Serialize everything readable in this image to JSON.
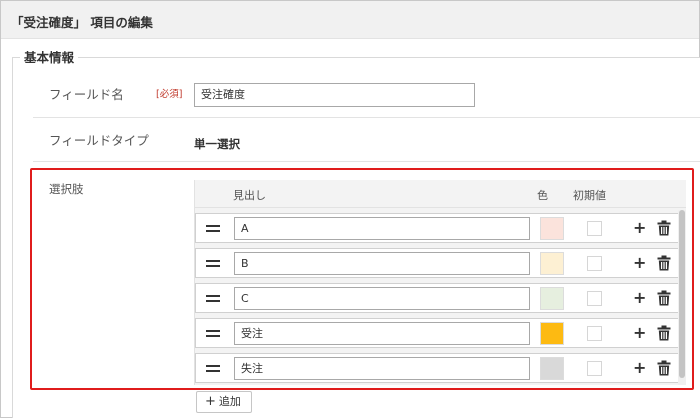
{
  "header": {
    "title": "「受注確度」 項目の編集"
  },
  "section": {
    "title": "基本情報"
  },
  "fields": {
    "name_label": "フィールド名",
    "required_tag": "[必須]",
    "name_value": "受注確度",
    "type_label": "フィールドタイプ",
    "type_value": "単一選択",
    "choices_label": "選択肢"
  },
  "table": {
    "col_heading": "見出し",
    "col_color": "色",
    "col_default": "初期値",
    "rows": [
      {
        "label": "A",
        "color": "#fbe3dc",
        "default": false
      },
      {
        "label": "B",
        "color": "#fdf0d3",
        "default": false
      },
      {
        "label": "C",
        "color": "#e6efdf",
        "default": false
      },
      {
        "label": "受注",
        "color": "#fdba12",
        "default": false
      },
      {
        "label": "失注",
        "color": "#d9d9d9",
        "default": false
      }
    ]
  },
  "add_button": {
    "label": "追加"
  },
  "icons": {
    "drag": "drag-handle-icon",
    "add": "plus-icon",
    "delete": "trash-icon"
  },
  "accent": {
    "highlight_border": "#e01c1c",
    "required": "#c0392b"
  }
}
